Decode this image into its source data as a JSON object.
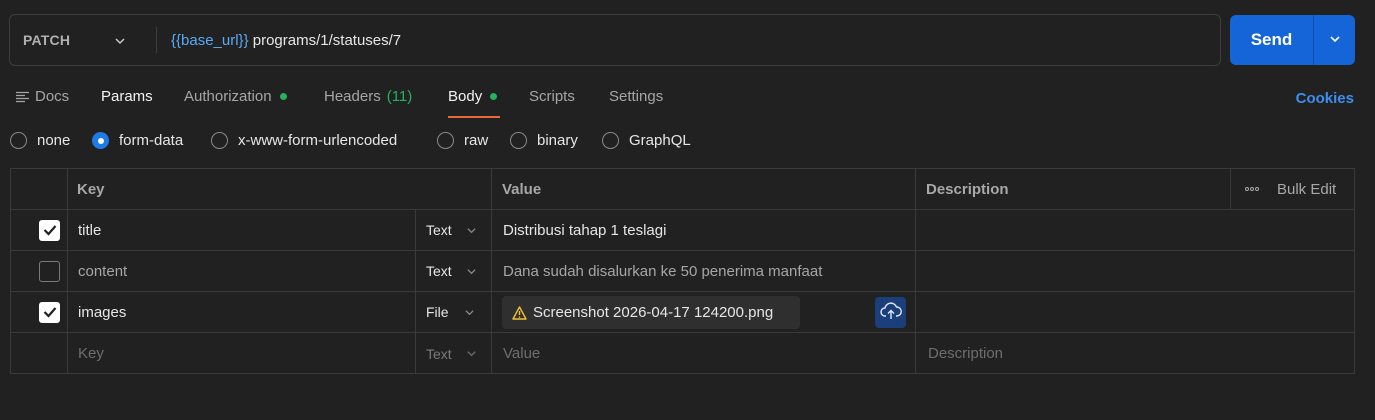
{
  "request": {
    "method": "PATCH",
    "url_variable": "{{base_url}}",
    "url_path": " programs/1/statuses/7",
    "send_label": "Send"
  },
  "tabs": [
    {
      "label": "Docs"
    },
    {
      "label": "Params"
    },
    {
      "label": "Authorization",
      "indicator": "green-dot"
    },
    {
      "label": "Headers",
      "count": "(11)"
    },
    {
      "label": "Body",
      "indicator": "green-dot",
      "active": true
    },
    {
      "label": "Scripts"
    },
    {
      "label": "Settings"
    }
  ],
  "cookies_label": "Cookies",
  "body_types": [
    {
      "label": "none"
    },
    {
      "label": "form-data",
      "selected": true
    },
    {
      "label": "x-www-form-urlencoded"
    },
    {
      "label": "raw"
    },
    {
      "label": "binary"
    },
    {
      "label": "GraphQL"
    }
  ],
  "table": {
    "headers": {
      "key": "Key",
      "value": "Value",
      "description": "Description",
      "bulk_edit": "Bulk Edit"
    },
    "rows": [
      {
        "checked": true,
        "key": "title",
        "type": "Text",
        "value": "Distribusi tahap 1 teslagi"
      },
      {
        "checked": false,
        "key": "content",
        "type": "Text",
        "value": "Dana sudah disalurkan ke 50 penerima manfaat"
      },
      {
        "checked": true,
        "key": "images",
        "type": "File",
        "file_name": "Screenshot 2026-04-17 124200.png"
      }
    ],
    "new_row": {
      "key_placeholder": "Key",
      "type": "Text",
      "value_placeholder": "Value",
      "description_placeholder": "Description"
    }
  },
  "colors": {
    "accent_blue": "#1565d8",
    "active_tab_underline": "#e8683b",
    "indicator_green": "#22b35c",
    "url_variable": "#5aa9f5",
    "warning_yellow": "#f0c232"
  }
}
